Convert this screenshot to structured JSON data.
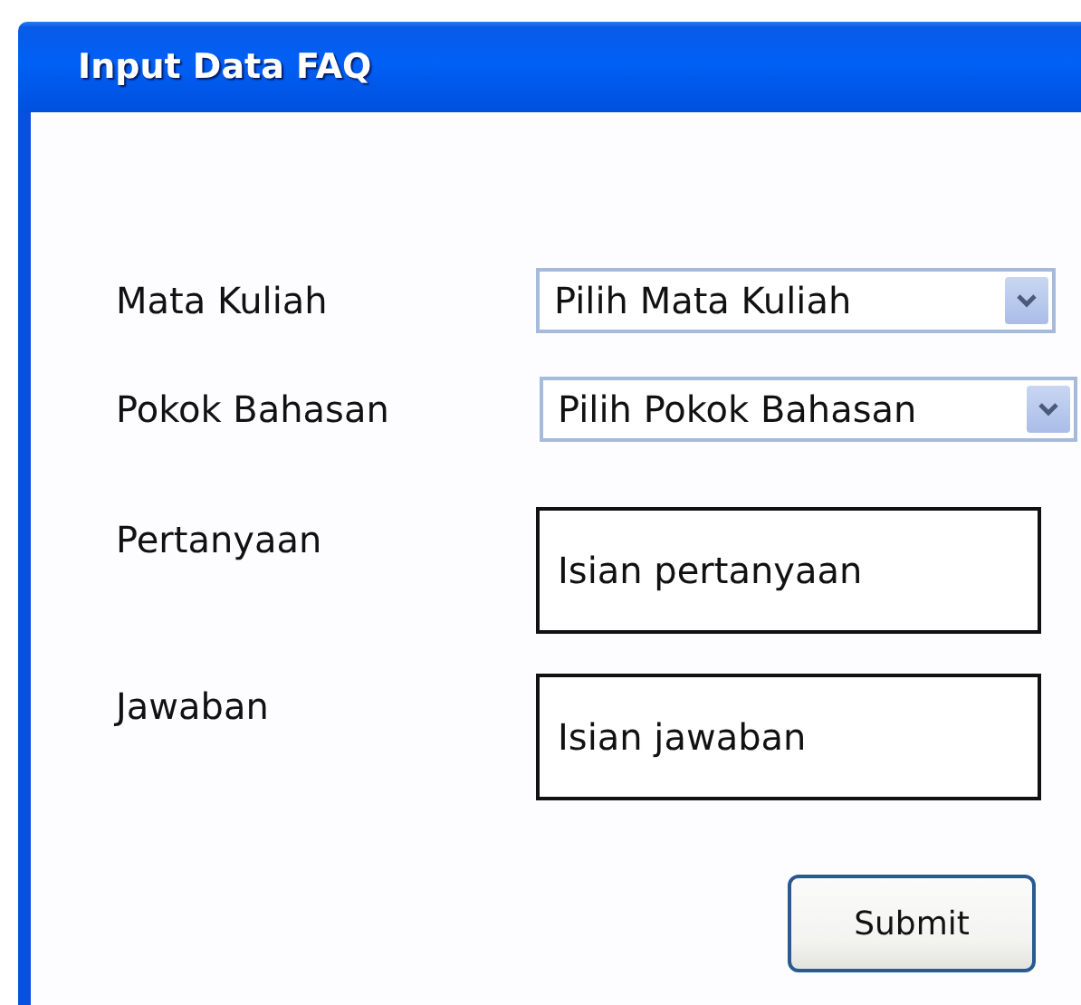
{
  "window": {
    "title": "Input Data FAQ"
  },
  "fields": [
    {
      "kind": "select",
      "label": "Mata Kuliah",
      "value": "Pilih Mata Kuliah"
    },
    {
      "kind": "select",
      "label": "Pokok Bahasan",
      "value": "Pilih Pokok Bahasan"
    },
    {
      "kind": "textarea",
      "label": "Pertanyaan",
      "value": "Isian pertanyaan"
    },
    {
      "kind": "textarea",
      "label": "Jawaban",
      "value": "Isian jawaban"
    }
  ],
  "buttons": [
    "Submit"
  ]
}
